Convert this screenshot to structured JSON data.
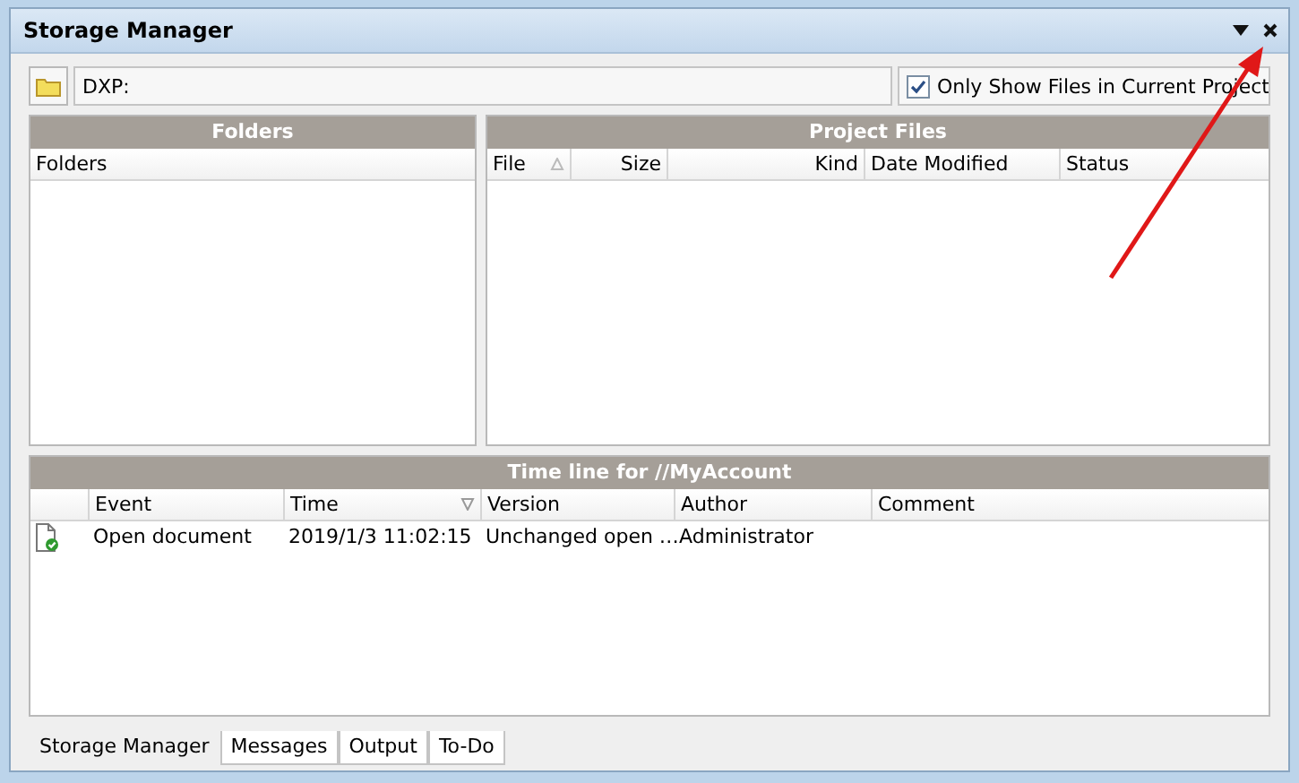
{
  "window": {
    "title": "Storage Manager"
  },
  "path_bar": {
    "value": "DXP:",
    "filter": {
      "label": "Only Show Files in Current Project",
      "checked": true
    }
  },
  "folders": {
    "title": "Folders",
    "columns": [
      {
        "label": "Folders",
        "sorted": false
      }
    ]
  },
  "project_files": {
    "title": "Project Files",
    "columns": [
      {
        "label": "File",
        "sorted": true,
        "descending": false
      },
      {
        "label": "Size",
        "sorted": false
      },
      {
        "label": "Kind",
        "sorted": false
      },
      {
        "label": "Date Modified",
        "sorted": false
      },
      {
        "label": "Status",
        "sorted": false
      }
    ]
  },
  "timeline": {
    "title": "Time line for //MyAccount",
    "columns": [
      {
        "label": "Event",
        "sorted": false
      },
      {
        "label": "Time",
        "sorted": true,
        "descending": true
      },
      {
        "label": "Version",
        "sorted": false
      },
      {
        "label": "Author",
        "sorted": false
      },
      {
        "label": "Comment",
        "sorted": false
      }
    ],
    "rows": [
      {
        "kind": "document-ok",
        "cells": [
          "Open document",
          "2019/1/3 11:02:15",
          "Unchanged open …",
          "Administrator"
        ]
      }
    ]
  },
  "tabs": [
    {
      "label": "Storage Manager",
      "selected": true
    },
    {
      "label": "Messages",
      "selected": false
    },
    {
      "label": "Output",
      "selected": false
    },
    {
      "label": "To-Do",
      "selected": false
    }
  ]
}
